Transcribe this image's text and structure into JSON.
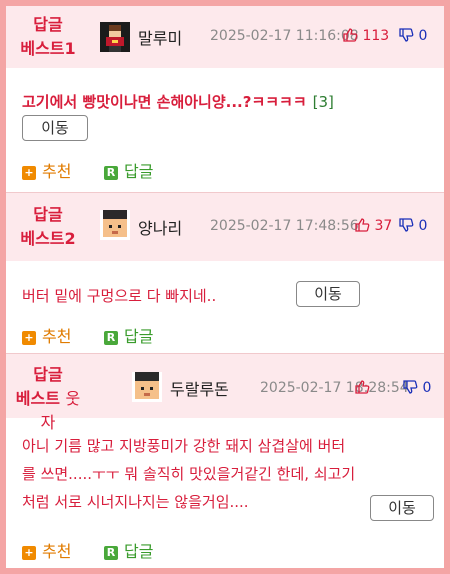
{
  "posts": [
    {
      "rank_line1": "답글",
      "rank_line2": "베스트1",
      "rank_extra": "",
      "nickname": "말루미",
      "avatar": "dark-pixel-character-avatar",
      "date": "2025-02-17 11:16:08",
      "likes": "113",
      "dislikes": "0",
      "title": "고기에서 빵맛이나면 손해아니양...?ㅋㅋㅋㅋ",
      "comment_count": "[3]",
      "move_label": "이동",
      "recommend_label": "추천",
      "reply_label": "답글"
    },
    {
      "rank_line1": "답글",
      "rank_line2": "베스트2",
      "rank_extra": "",
      "nickname": "양나리",
      "avatar": "pixel-face-avatar",
      "date": "2025-02-17 17:48:56",
      "likes": "37",
      "dislikes": "0",
      "body": "버터 밑에 구멍으로 다 빠지네..",
      "move_label": "이동",
      "recommend_label": "추천",
      "reply_label": "답글"
    },
    {
      "rank_line1": "답글",
      "rank_line2": "베스트",
      "rank_extra": "웃자",
      "nickname": "두랄루돈",
      "avatar": "pixel-face-avatar",
      "date": "2025-02-17 18:28:54",
      "likes": "",
      "dislikes": "0",
      "body": "아니 기름 많고 지방풍미가 강한 돼지 삼겹살에 버터를 쓰면.....ㅜㅜ 뭐 솔직히 맛있을거같긴 한데, 쇠고기처럼 서로 시너지나지는 않을거임....",
      "move_label": "이동",
      "recommend_label": "추천",
      "reply_label": "답글"
    }
  ],
  "colors": {
    "accent": "#d81e3c",
    "header_bg": "#fde9ec",
    "frame": "#f4a5a5",
    "recommend": "#e07b00",
    "reply": "#3a9c2c",
    "dislike": "#1a2fb8"
  }
}
